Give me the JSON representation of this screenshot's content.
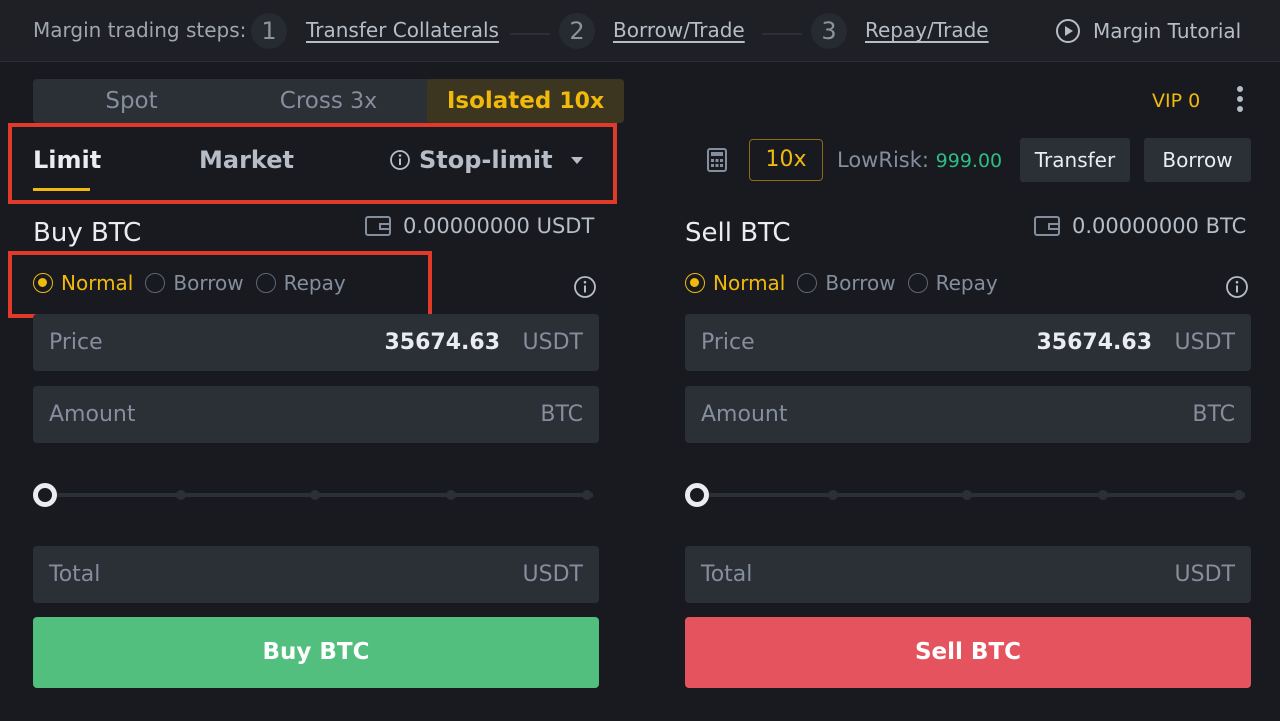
{
  "steps": {
    "label": "Margin trading steps:",
    "items": [
      {
        "num": "1",
        "text": "Transfer Collaterals"
      },
      {
        "num": "2",
        "text": "Borrow/Trade"
      },
      {
        "num": "3",
        "text": "Repay/Trade"
      }
    ],
    "tutorial": "Margin Tutorial"
  },
  "mode_tabs": [
    {
      "label": "Spot",
      "lev": ""
    },
    {
      "label": "Cross",
      "lev": "3x"
    },
    {
      "label": "Isolated",
      "lev": "10x"
    }
  ],
  "vip": "VIP 0",
  "order_tabs": {
    "limit": "Limit",
    "market": "Market",
    "stop_limit": "Stop-limit"
  },
  "toolbar": {
    "leverage": "10x",
    "risk_label": "LowRisk:",
    "risk_value": "999.00",
    "transfer": "Transfer",
    "borrow": "Borrow"
  },
  "buy": {
    "title": "Buy BTC",
    "balance": "0.00000000 USDT",
    "radios": [
      "Normal",
      "Borrow",
      "Repay"
    ],
    "price_label": "Price",
    "price_value": "35674.63",
    "price_unit": "USDT",
    "amount_label": "Amount",
    "amount_unit": "BTC",
    "total_label": "Total",
    "total_unit": "USDT",
    "button": "Buy BTC"
  },
  "sell": {
    "title": "Sell BTC",
    "balance": "0.00000000 BTC",
    "radios": [
      "Normal",
      "Borrow",
      "Repay"
    ],
    "price_label": "Price",
    "price_value": "35674.63",
    "price_unit": "USDT",
    "amount_label": "Amount",
    "amount_unit": "BTC",
    "total_label": "Total",
    "total_unit": "USDT",
    "button": "Sell BTC"
  },
  "colors": {
    "accent": "#f0b90b",
    "buy": "#52bf7e",
    "sell": "#e5535f",
    "highlight": "#e23a2a",
    "risk": "#2ebd85"
  }
}
